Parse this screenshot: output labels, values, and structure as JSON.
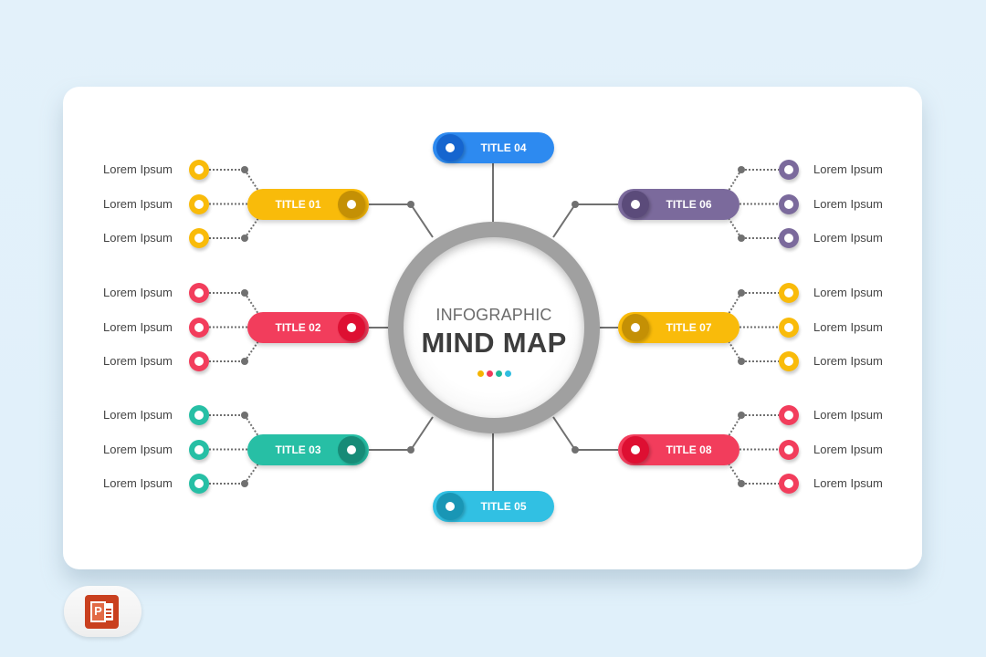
{
  "slide": {
    "center": {
      "subtitle": "INFOGRAPHIC",
      "title": "MIND MAP",
      "dot_colors": [
        "#f5b400",
        "#f0395a",
        "#1fb89a",
        "#2fbde0"
      ]
    },
    "colors": {
      "yellow": "#f9bb0a",
      "yellow_dark": "#c49005",
      "red": "#f23d5c",
      "red_dark": "#de0f32",
      "teal": "#27bfa5",
      "teal_dark": "#178b77",
      "blue": "#2d8af0",
      "blue_dark": "#1565cf",
      "cyan": "#31c0e3",
      "cyan_dark": "#1996b5",
      "purple": "#7b6a9c",
      "purple_dark": "#5b4b7a",
      "connector": "#707070"
    },
    "branches": [
      {
        "id": "01",
        "title": "TITLE 01",
        "color": "yellow",
        "items": [
          "Lorem Ipsum",
          "Lorem Ipsum",
          "Lorem Ipsum"
        ]
      },
      {
        "id": "02",
        "title": "TITLE 02",
        "color": "red",
        "items": [
          "Lorem Ipsum",
          "Lorem Ipsum",
          "Lorem Ipsum"
        ]
      },
      {
        "id": "03",
        "title": "TITLE 03",
        "color": "teal",
        "items": [
          "Lorem Ipsum",
          "Lorem Ipsum",
          "Lorem Ipsum"
        ]
      },
      {
        "id": "04",
        "title": "TITLE 04",
        "color": "blue",
        "items": []
      },
      {
        "id": "05",
        "title": "TITLE 05",
        "color": "cyan",
        "items": []
      },
      {
        "id": "06",
        "title": "TITLE 06",
        "color": "purple",
        "items": [
          "Lorem Ipsum",
          "Lorem Ipsum",
          "Lorem Ipsum"
        ]
      },
      {
        "id": "07",
        "title": "TITLE 07",
        "color": "yellow",
        "items": [
          "Lorem Ipsum",
          "Lorem Ipsum",
          "Lorem Ipsum"
        ]
      },
      {
        "id": "08",
        "title": "TITLE 08",
        "color": "red",
        "items": [
          "Lorem Ipsum",
          "Lorem Ipsum",
          "Lorem Ipsum"
        ]
      }
    ]
  },
  "badge": {
    "icon": "powerpoint-icon",
    "letter": "P"
  }
}
